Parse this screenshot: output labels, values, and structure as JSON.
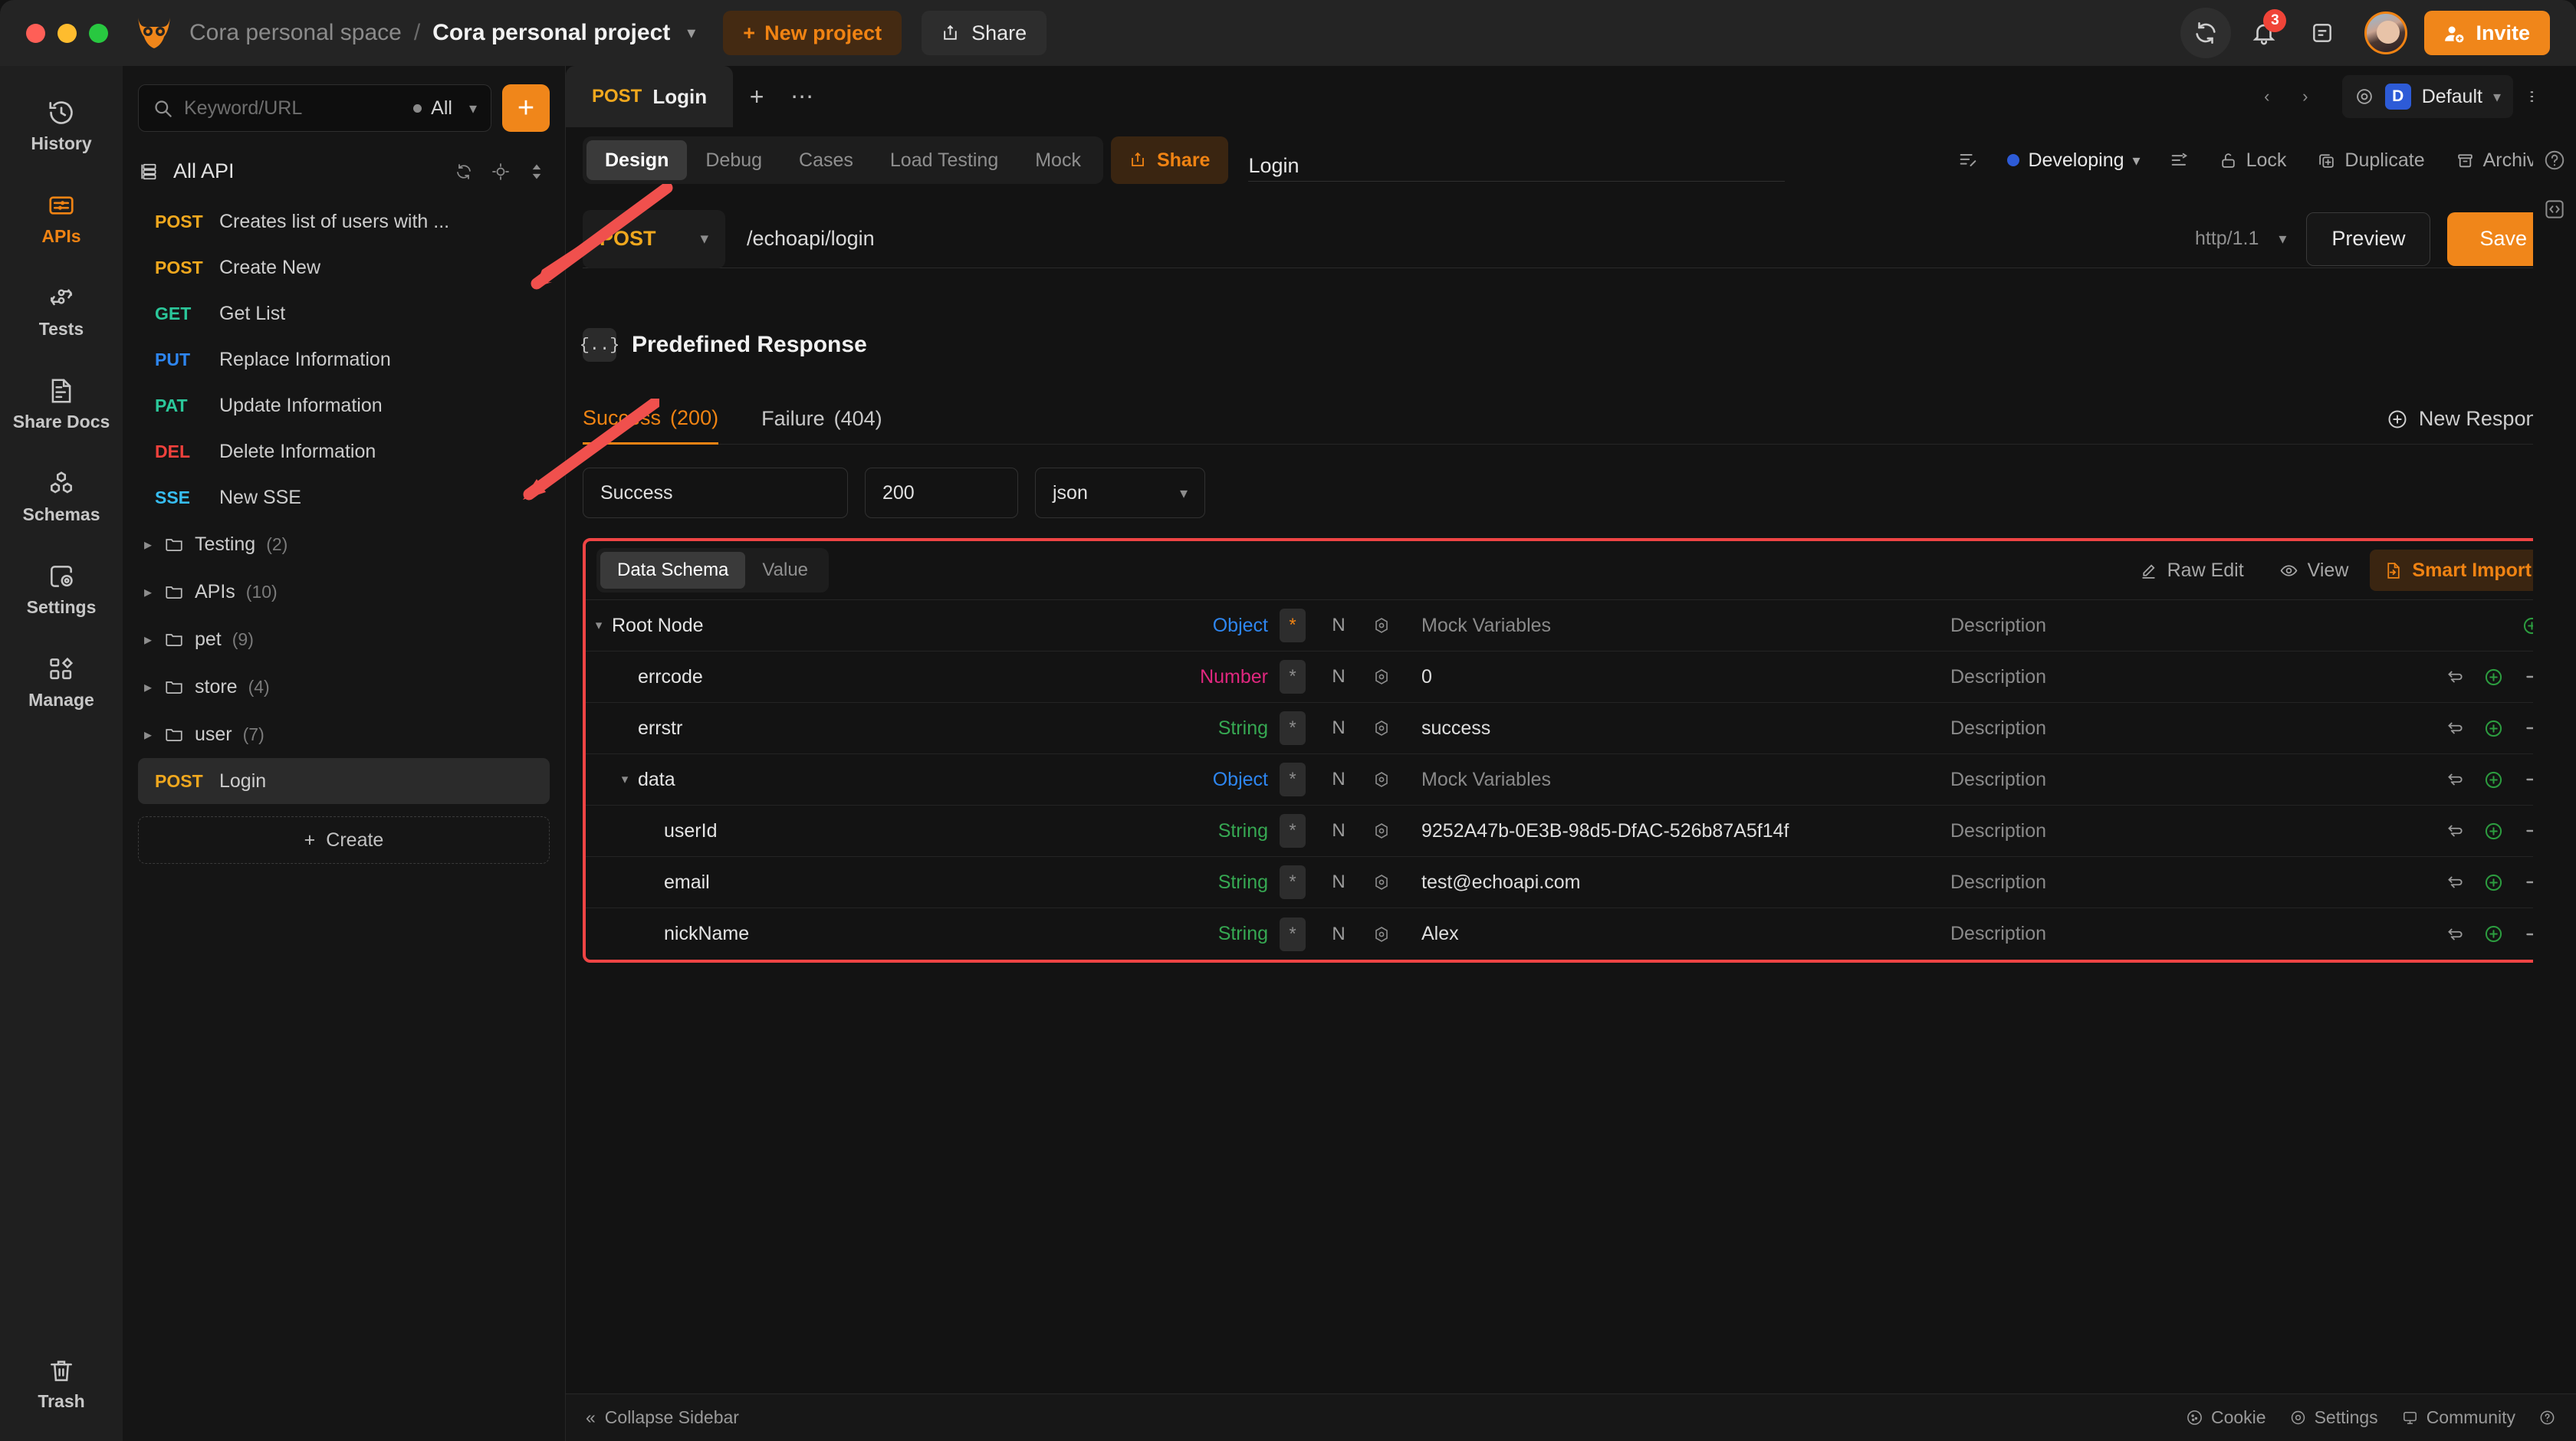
{
  "titlebar": {
    "space": "Cora personal space",
    "separator": "/",
    "project": "Cora personal project",
    "new_project": "New project",
    "share": "Share",
    "invite": "Invite",
    "notification_count": "3"
  },
  "rail": {
    "items": [
      {
        "label": "History",
        "icon": "history-icon",
        "active": false
      },
      {
        "label": "APIs",
        "icon": "apis-icon",
        "active": true
      },
      {
        "label": "Tests",
        "icon": "tests-icon",
        "active": false
      },
      {
        "label": "Share Docs",
        "icon": "share-docs-icon",
        "active": false
      },
      {
        "label": "Schemas",
        "icon": "schemas-icon",
        "active": false
      },
      {
        "label": "Settings",
        "icon": "settings-icon",
        "active": false
      },
      {
        "label": "Manage",
        "icon": "manage-icon",
        "active": false
      }
    ],
    "trash": "Trash"
  },
  "sidebar": {
    "search_placeholder": "Keyword/URL",
    "filter_value": "All",
    "all_api_label": "All API",
    "create_label": "Create",
    "apis": [
      {
        "verb": "POST",
        "verb_class": "v-post",
        "name": "Creates list of users with ..."
      },
      {
        "verb": "POST",
        "verb_class": "v-post",
        "name": "Create New"
      },
      {
        "verb": "GET",
        "verb_class": "v-get",
        "name": "Get List"
      },
      {
        "verb": "PUT",
        "verb_class": "v-put",
        "name": "Replace Information"
      },
      {
        "verb": "PAT",
        "verb_class": "v-pat",
        "name": "Update Information"
      },
      {
        "verb": "DEL",
        "verb_class": "v-del",
        "name": "Delete Information"
      },
      {
        "verb": "SSE",
        "verb_class": "v-sse",
        "name": "New SSE"
      }
    ],
    "folders": [
      {
        "name": "Testing",
        "count": "(2)"
      },
      {
        "name": "APIs",
        "count": "(10)"
      },
      {
        "name": "pet",
        "count": "(9)"
      },
      {
        "name": "store",
        "count": "(4)"
      },
      {
        "name": "user",
        "count": "(7)"
      }
    ],
    "selected_api": {
      "verb": "POST",
      "verb_class": "v-post",
      "name": "Login"
    }
  },
  "tabstrip": {
    "open_tab": {
      "verb": "POST",
      "name": "Login"
    },
    "env_badge": "D",
    "env_name": "Default"
  },
  "toolbar": {
    "segments": [
      {
        "label": "Design",
        "active": true
      },
      {
        "label": "Debug",
        "active": false
      },
      {
        "label": "Cases",
        "active": false
      },
      {
        "label": "Load Testing",
        "active": false
      },
      {
        "label": "Mock",
        "active": false
      }
    ],
    "share_label": "Share",
    "api_title": "Login",
    "status": "Developing",
    "lock": "Lock",
    "duplicate": "Duplicate",
    "archive": "Archive"
  },
  "urlbar": {
    "method": "POST",
    "url": "/echoapi/login",
    "protocol": "http/1.1",
    "preview": "Preview",
    "save": "Save"
  },
  "predefined_response": {
    "title": "Predefined Response",
    "tabs": [
      {
        "label": "Success",
        "code": "(200)",
        "active": true
      },
      {
        "label": "Failure",
        "code": "(404)",
        "active": false
      }
    ],
    "new_response": "New Response",
    "name_value": "Success",
    "code_value": "200",
    "type_value": "json"
  },
  "schema_panel": {
    "view_tabs": [
      {
        "label": "Data Schema",
        "active": true
      },
      {
        "label": "Value",
        "active": false
      }
    ],
    "raw_edit": "Raw Edit",
    "view": "View",
    "smart_import": "Smart Import",
    "description_placeholder": "Description",
    "rows": [
      {
        "key": "Root Node",
        "indent": 0,
        "caret": "▾",
        "type": "Object",
        "type_class": "t-object",
        "required": "*",
        "required_on": true,
        "nullable": "N",
        "value": "Mock Variables",
        "value_muted": true,
        "desc": "Description",
        "actions": "add-only"
      },
      {
        "key": "errcode",
        "indent": 1,
        "caret": "",
        "type": "Number",
        "type_class": "t-number",
        "required": "*",
        "required_on": false,
        "nullable": "N",
        "value": "0",
        "value_muted": false,
        "desc": "Description",
        "actions": "full"
      },
      {
        "key": "errstr",
        "indent": 1,
        "caret": "",
        "type": "String",
        "type_class": "t-string",
        "required": "*",
        "required_on": false,
        "nullable": "N",
        "value": "success",
        "value_muted": false,
        "desc": "Description",
        "actions": "full"
      },
      {
        "key": "data",
        "indent": 1,
        "caret": "▾",
        "type": "Object",
        "type_class": "t-object",
        "required": "*",
        "required_on": false,
        "nullable": "N",
        "value": "Mock Variables",
        "value_muted": true,
        "desc": "Description",
        "actions": "full"
      },
      {
        "key": "userId",
        "indent": 2,
        "caret": "",
        "type": "String",
        "type_class": "t-string",
        "required": "*",
        "required_on": false,
        "nullable": "N",
        "value": "9252A47b-0E3B-98d5-DfAC-526b87A5f14f",
        "value_muted": false,
        "desc": "Description",
        "actions": "full"
      },
      {
        "key": "email",
        "indent": 2,
        "caret": "",
        "type": "String",
        "type_class": "t-string",
        "required": "*",
        "required_on": false,
        "nullable": "N",
        "value": "test@echoapi.com",
        "value_muted": false,
        "desc": "Description",
        "actions": "full"
      },
      {
        "key": "nickName",
        "indent": 2,
        "caret": "",
        "type": "String",
        "type_class": "t-string",
        "required": "*",
        "required_on": false,
        "nullable": "N",
        "value": "Alex",
        "value_muted": false,
        "desc": "Description",
        "actions": "full"
      }
    ]
  },
  "bottombar": {
    "collapse_sidebar": "Collapse Sidebar",
    "cookie": "Cookie",
    "settings": "Settings",
    "community": "Community"
  },
  "colors": {
    "accent": "#f0861a",
    "annotation": "#ef4444",
    "status_blue": "#2d5bd7",
    "type_object": "#2e86f0",
    "type_number": "#e0277f",
    "type_string": "#36a852"
  }
}
